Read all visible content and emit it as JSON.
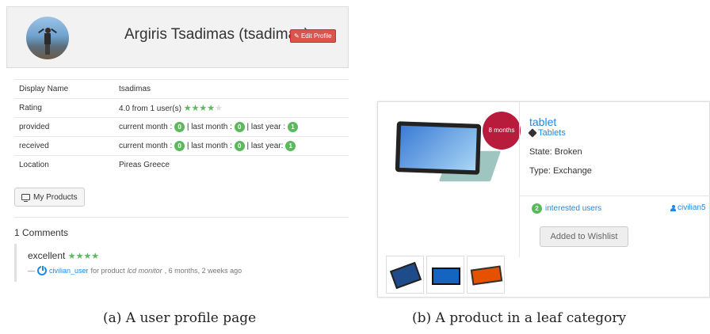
{
  "profile": {
    "name": "Argiris Tsadimas (tsadimas)",
    "edit_label": "Edit Profile",
    "rows": [
      {
        "key": "Display Name",
        "value": "tsadimas"
      },
      {
        "key": "Rating",
        "value": "4.0 from 1 user(s)"
      },
      {
        "key": "provided",
        "current_month_label": "current month :",
        "current_month": "0",
        "last_month_label": "last month :",
        "last_month": "0",
        "last_year_label": "last year :",
        "last_year": "1"
      },
      {
        "key": "received",
        "current_month_label": "current month :",
        "current_month": "0",
        "last_month_label": "last month :",
        "last_month": "0",
        "last_year_label": "last year:",
        "last_year": "1"
      },
      {
        "key": "Location",
        "value": "Pireas Greece"
      }
    ],
    "rating": {
      "stars_filled": 4,
      "stars_total": 5
    },
    "my_products_label": "My Products",
    "comments_title": "1 Comments",
    "comment": {
      "text": "excellent",
      "stars": 4,
      "dash": "—",
      "user": "civilian_user",
      "for_product": "for product",
      "product": "lcd monitor",
      "time": ", 6 months, 2 weeks ago"
    }
  },
  "product": {
    "age_badge": "8 months",
    "title": "tablet",
    "category": "Tablets",
    "state": "State: Broken",
    "type": "Type: Exchange",
    "interested_count": "2",
    "interested_label": "interested users",
    "owner": "civilian5",
    "wishlist_label": "Added to Wishlist"
  },
  "captions": {
    "a": "(a) A user profile page",
    "b": "(b) A product in a leaf category"
  },
  "colors": {
    "badge_green": "#5cb85c",
    "link_blue": "#1e88e5",
    "edit_red": "#d9534f",
    "months_badge": "#b71c3c"
  }
}
